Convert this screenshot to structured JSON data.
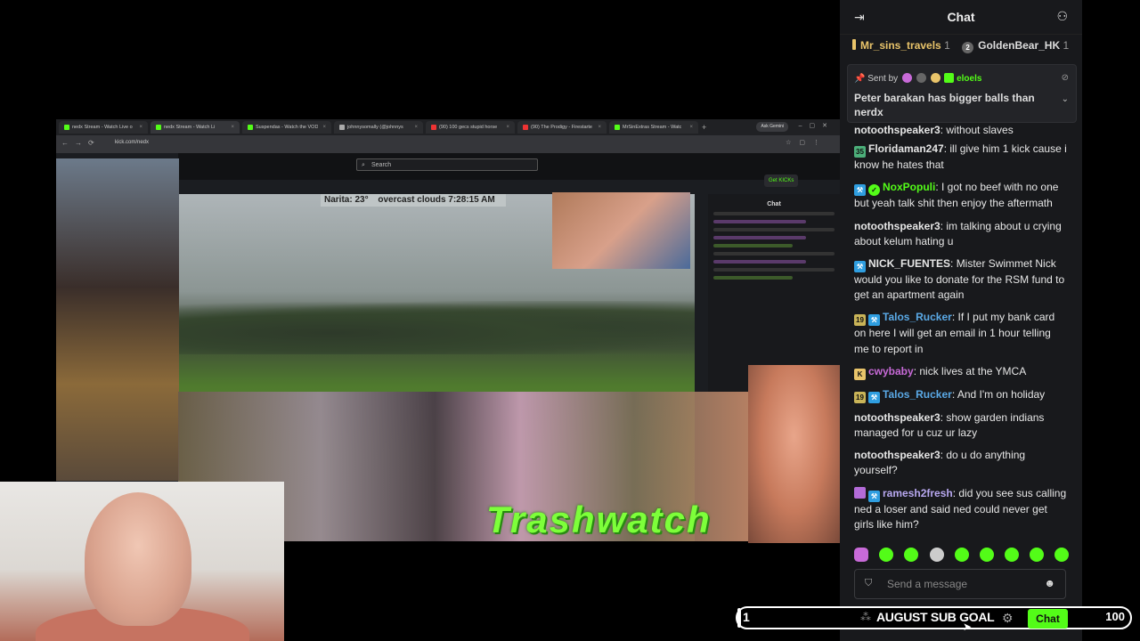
{
  "browser": {
    "tabs": [
      {
        "label": "nedx Stream - Watch Live o",
        "icon": "kick-favicon",
        "active": false
      },
      {
        "label": "nedx Stream - Watch Li",
        "icon": "kick-favicon",
        "active": true
      },
      {
        "label": "Suspendas - Watch the VOD",
        "icon": "kick-favicon",
        "active": false
      },
      {
        "label": "johnnysomally (@johnnys",
        "icon": "x-favicon",
        "active": false
      },
      {
        "label": "(90) 100 gecs stupid horse",
        "icon": "youtube-favicon",
        "active": false
      },
      {
        "label": "(90) The Prodigy - Firestarte",
        "icon": "youtube-favicon",
        "active": false
      },
      {
        "label": "MrSinExtras Stream - Watc",
        "icon": "kick-favicon",
        "active": false
      }
    ],
    "new_tab": "+",
    "gemini_label": "Ask Gemini",
    "url": "kick.com/nedx",
    "search_placeholder": "Search",
    "get_kicks": "Get KICKs",
    "inner_chat_title": "Chat",
    "weather": {
      "location": "Narita: 23°",
      "conditions": "overcast clouds 7:28:15 AM"
    },
    "overlay_text": "Trashwatch"
  },
  "chat": {
    "title": "Chat",
    "top_gifters": [
      {
        "name": "Mr_sins_travels",
        "count": "1"
      },
      {
        "name": "GoldenBear_HK",
        "count": "1"
      }
    ],
    "pinned": {
      "sent_by_label": "Sent by",
      "sender": "eloels",
      "message": "Peter barakan has bigger balls than nerdx"
    },
    "messages": [
      {
        "user": "notoothspeaker3",
        "color": "#e6e6e6",
        "badges": [],
        "text": "without slaves"
      },
      {
        "user": "Floridaman247",
        "color": "#e6e6e6",
        "badges": [
          "sub"
        ],
        "badge_text": [
          "35"
        ],
        "text": "ill give him 1 kick cause i know he hates that"
      },
      {
        "user": "NoxPopuli",
        "color": "#53fc18",
        "badges": [
          "mod",
          "ver"
        ],
        "text": "I got no beef with no one but yeah talk shit then enjoy the aftermath"
      },
      {
        "user": "notoothspeaker3",
        "color": "#e6e6e6",
        "badges": [],
        "text": "im talking about u crying about kelum hating u"
      },
      {
        "user": "NICK_FUENTES",
        "color": "#e6e6e6",
        "badges": [
          "mod"
        ],
        "text": "Mister Swimmet Nick would you like to donate for the RSM fund to get an apartment again"
      },
      {
        "user": "Talos_Rucker",
        "color": "#5aa9e6",
        "badges": [
          "sub19",
          "mod"
        ],
        "badge_text": [
          "19"
        ],
        "text": "If I put my bank card on here I will get an email in 1 hour telling me to report in"
      },
      {
        "user": "cwybaby",
        "color": "#c86ad8",
        "badges": [
          "kik"
        ],
        "badge_text": [
          "K"
        ],
        "text": "nick lives at the YMCA"
      },
      {
        "user": "Talos_Rucker",
        "color": "#5aa9e6",
        "badges": [
          "sub19",
          "mod"
        ],
        "badge_text": [
          "19"
        ],
        "text": "And I'm on holiday"
      },
      {
        "user": "notoothspeaker3",
        "color": "#e6e6e6",
        "badges": [],
        "text": "show garden indians managed for u cuz ur lazy"
      },
      {
        "user": "notoothspeaker3",
        "color": "#e6e6e6",
        "badges": [],
        "text": "do u do anything yourself?"
      },
      {
        "user": "ramesh2fresh",
        "color": "#b8a8f0",
        "badges": [
          "og",
          "mod"
        ],
        "text": "did you see sus calling ned a loser and said ned could never get girls like him?"
      }
    ],
    "input_placeholder": "Send a message",
    "chat_button": "Chat"
  },
  "sub_goal": {
    "title": "AUGUST SUB GOAL",
    "current": "1",
    "target": "100",
    "progress_fraction": 0.01
  },
  "colors": {
    "kick_green": "#53fc18",
    "chat_bg": "#18191c"
  }
}
